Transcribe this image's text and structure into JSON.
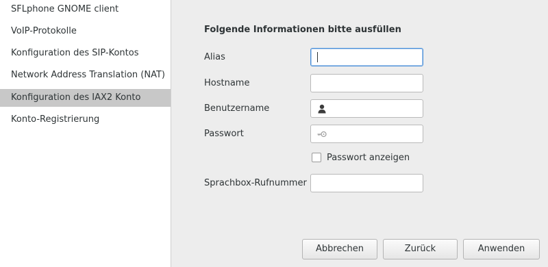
{
  "sidebar": {
    "items": [
      {
        "label": "SFLphone GNOME client"
      },
      {
        "label": "VoIP-Protokolle"
      },
      {
        "label": "Konfiguration des SIP-Kontos"
      },
      {
        "label": "Network Address Translation (NAT)"
      },
      {
        "label": "Konfiguration des IAX2 Konto",
        "selected": true
      },
      {
        "label": "Konto-Registrierung"
      }
    ]
  },
  "form": {
    "heading": "Folgende Informationen bitte ausfüllen",
    "fields": {
      "alias": {
        "label": "Alias",
        "value": ""
      },
      "hostname": {
        "label": "Hostname",
        "value": ""
      },
      "username": {
        "label": "Benutzername",
        "value": "",
        "icon": "user-icon"
      },
      "password": {
        "label": "Passwort",
        "value": "",
        "icon": "key-icon"
      },
      "voicemail": {
        "label": "Sprachbox-Rufnummer",
        "value": ""
      }
    },
    "show_password": {
      "label": "Passwort anzeigen",
      "checked": false
    }
  },
  "buttons": {
    "cancel": "Abbrechen",
    "back": "Zurück",
    "apply": "Anwenden"
  },
  "colors": {
    "selected_row": "#c8c8c8",
    "focus_border": "#4a90d9"
  }
}
